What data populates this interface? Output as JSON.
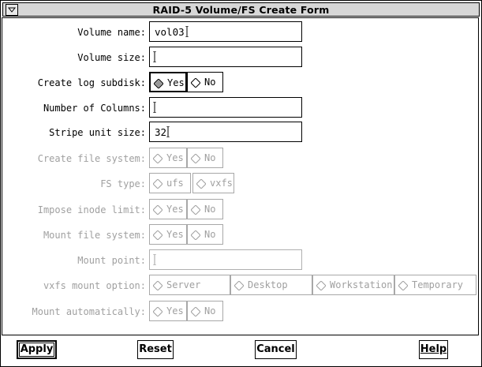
{
  "window": {
    "title": "RAID-5 Volume/FS Create Form",
    "menu_icon": "window-menu-icon"
  },
  "fields": {
    "volume_name": {
      "label": "Volume name:",
      "value": "vol03"
    },
    "volume_size": {
      "label": "Volume size:",
      "value": ""
    },
    "create_log_subdisk": {
      "label": "Create log subdisk:",
      "options": [
        "Yes",
        "No"
      ],
      "selected": "Yes"
    },
    "number_of_columns": {
      "label": "Number of Columns:",
      "value": ""
    },
    "stripe_unit_size": {
      "label": "Stripe unit size:",
      "value": "32"
    },
    "create_file_system": {
      "label": "Create file system:",
      "options": [
        "Yes",
        "No"
      ]
    },
    "fs_type": {
      "label": "FS type:",
      "options": [
        "ufs",
        "vxfs"
      ]
    },
    "impose_inode_limit": {
      "label": "Impose inode limit:",
      "options": [
        "Yes",
        "No"
      ]
    },
    "mount_file_system": {
      "label": "Mount file system:",
      "options": [
        "Yes",
        "No"
      ]
    },
    "mount_point": {
      "label": "Mount point:",
      "value": ""
    },
    "vxfs_mount_option": {
      "label": "vxfs mount option:",
      "options": [
        "Server",
        "Desktop",
        "Workstation",
        "Temporary"
      ]
    },
    "mount_automatically": {
      "label": "Mount automatically:",
      "options": [
        "Yes",
        "No"
      ]
    }
  },
  "buttons": {
    "apply": "Apply",
    "reset": "Reset",
    "cancel": "Cancel",
    "help": "Help"
  },
  "colors": {
    "disabled_text": "#a0a0a0",
    "titlebar": "#d7d7d7"
  }
}
